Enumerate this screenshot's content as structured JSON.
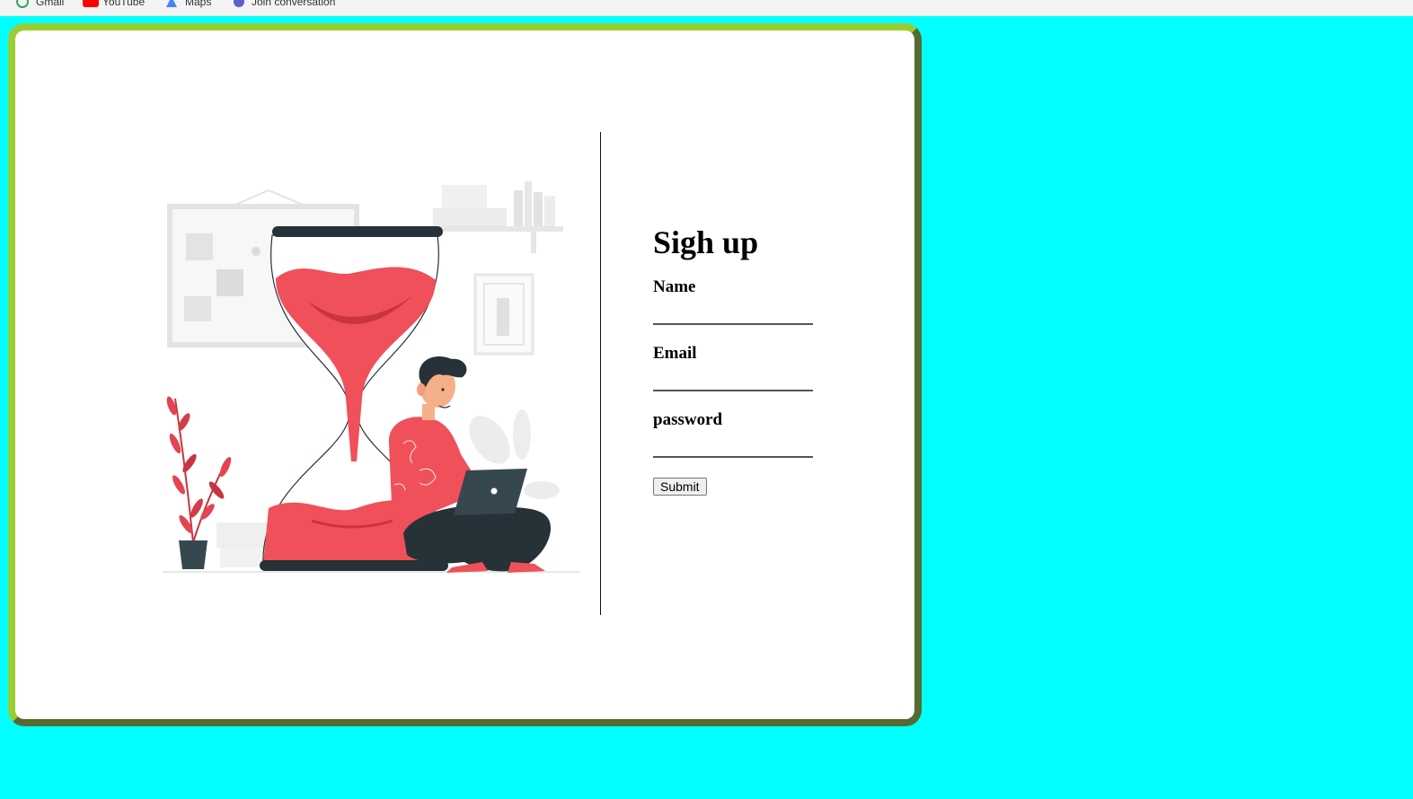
{
  "bookmarks": [
    {
      "label": "Gmail",
      "icon": "gmail-icon"
    },
    {
      "label": "YouTube",
      "icon": "youtube-icon"
    },
    {
      "label": "Maps",
      "icon": "maps-icon"
    },
    {
      "label": "Join conversation",
      "icon": "conversation-icon"
    }
  ],
  "form": {
    "title": "Sigh up",
    "name_label": "Name",
    "email_label": "Email",
    "password_label": "password",
    "name_value": "",
    "email_value": "",
    "password_value": "",
    "submit_label": "Submit"
  },
  "illustration": {
    "subject": "person-with-laptop-and-hourglass"
  },
  "colors": {
    "background": "#00ffff",
    "card": "#ffffff",
    "border": "#6b8e23",
    "accent_red": "#f0505a",
    "dark": "#263238"
  }
}
